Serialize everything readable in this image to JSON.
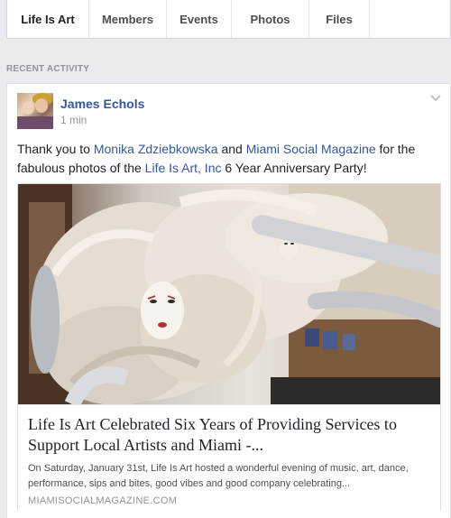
{
  "tabs": {
    "group_name": "Life Is Art",
    "members": "Members",
    "events": "Events",
    "photos": "Photos",
    "files": "Files"
  },
  "section_label": "RECENT ACTIVITY",
  "post": {
    "author": "James Echols",
    "timestamp": "1 min",
    "text": {
      "part1": "Thank you to ",
      "link1": "Monika Zdziebkowska",
      "part2": " and ",
      "link2": "Miami Social Magazine",
      "part3": " for the fabulous photos of the ",
      "link3": "Life Is Art, Inc",
      "part4": " 6 Year Anniversary Party!"
    },
    "preview": {
      "title": "Life Is Art Celebrated Six Years of Providing Services to Support Local Artists and Miami -...",
      "description": "On Saturday, January 31st, Life Is Art hosted a wonderful evening of music, art, dance, performance, sips and bites, good vibes and good company celebrating...",
      "domain": "MIAMISOCIALMAGAZINE.COM"
    }
  },
  "colors": {
    "link": "#365899",
    "page_background": "#e9ebee",
    "muted_text": "#90949c"
  },
  "icons": {
    "menu": "chevron-down-icon"
  }
}
